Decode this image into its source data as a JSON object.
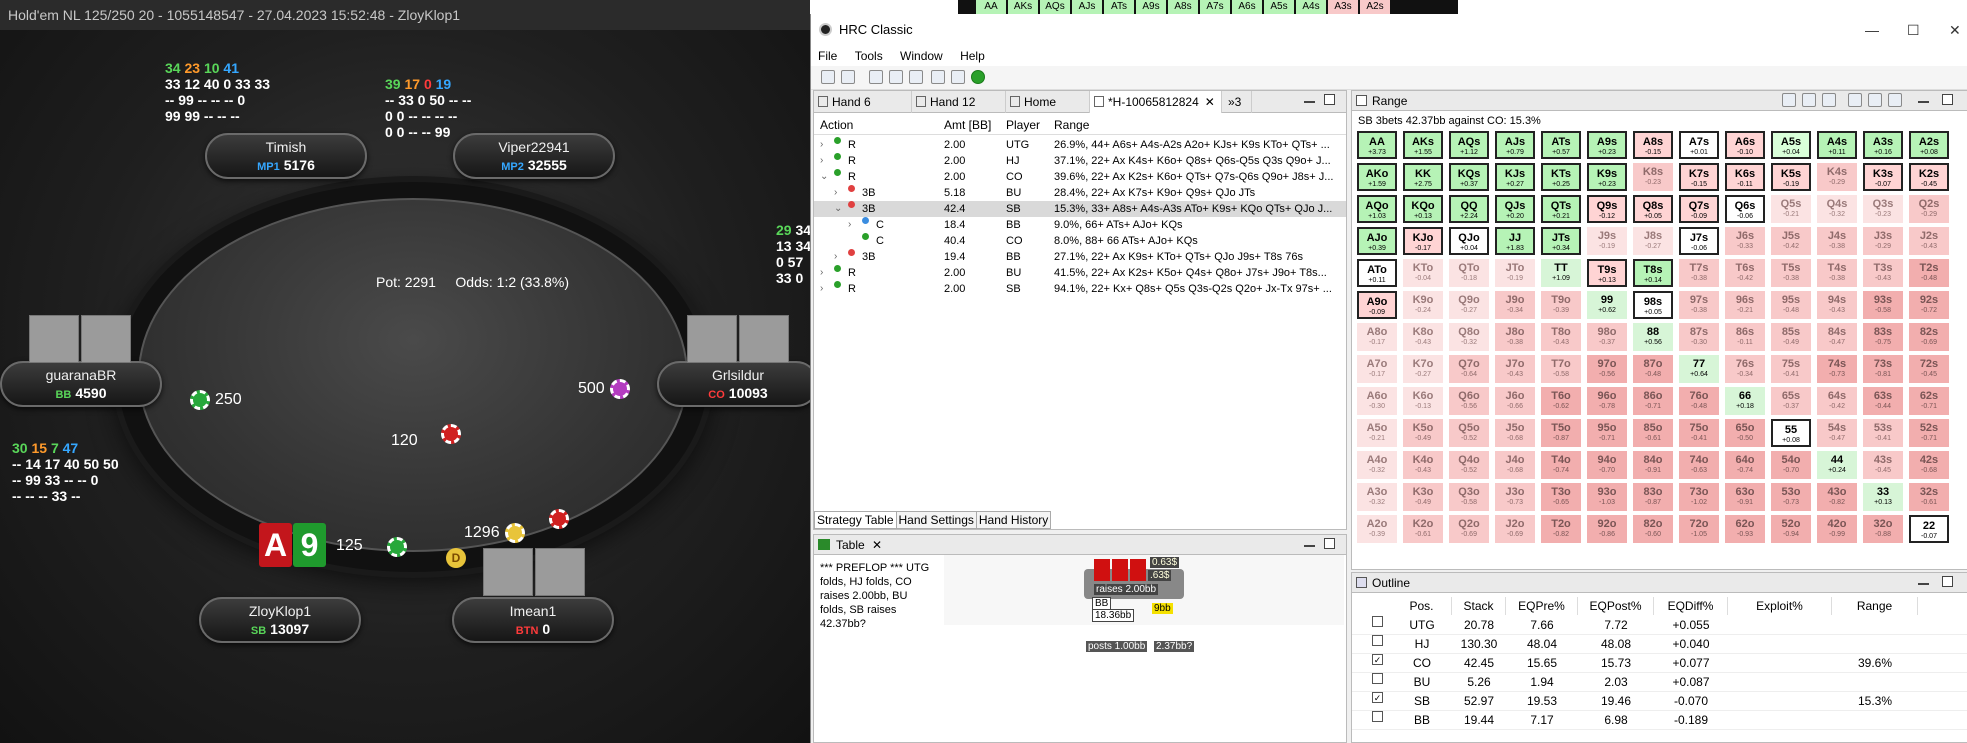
{
  "poker": {
    "title": "Hold'em NL 125/250 20 - 1055148547 - 27.04.2023 15:52:48 - ZloyKlop1",
    "pot_label": "Pot:",
    "pot_value": "2291",
    "odds_label": "Odds:",
    "odds_value": "1:2 (33.8%)",
    "players": {
      "timish": {
        "name": "Timish",
        "pos": "MP1",
        "stack": "5176"
      },
      "viper": {
        "name": "Viper22941",
        "pos": "MP2",
        "stack": "32555"
      },
      "guarana": {
        "name": "guaranaBR",
        "pos": "BB",
        "stack": "4590"
      },
      "grlsildur": {
        "name": "Grlsildur",
        "pos": "CO",
        "stack": "10093"
      },
      "zloy": {
        "name": "ZloyKlop1",
        "pos": "SB",
        "stack": "13097"
      },
      "imean": {
        "name": "Imean1",
        "pos": "BTN",
        "stack": "0"
      }
    },
    "stats": {
      "timish": {
        "a": "34",
        "b": "23",
        "c": "10",
        "d": "41",
        "l2": "33 12 40 0 33 33",
        "l3": "-- 99 -- -- -- 0",
        "l4": "99 99 -- -- --"
      },
      "viper": {
        "a": "39",
        "b": "17",
        "c": "0",
        "d": "19",
        "l2": "-- 33 0 50 -- --",
        "l3": "0 0 -- -- -- --",
        "l4": "0 0 -- -- 99"
      },
      "guarana": {
        "a": "30",
        "b": "15",
        "c": "7",
        "d": "47",
        "l2": "-- 14 17 40 50 50",
        "l3": "-- 99 33 -- -- 0",
        "l4": "-- -- -- 33 --"
      },
      "right": {
        "a": "29",
        "b": "34",
        "l2": "13 34",
        "l3": "0 57",
        "l4": "33 0"
      }
    },
    "bets": {
      "guarana": "250",
      "grlsildur": "500",
      "center": "120",
      "zloy": "125",
      "imean": "1296"
    },
    "hole_cards": {
      "c1": "A",
      "c2": "9"
    },
    "dealer": "D"
  },
  "strip": [
    "AA",
    "AKs",
    "AQs",
    "AJs",
    "ATs",
    "A9s",
    "A8s",
    "A7s",
    "A6s",
    "A5s",
    "A4s",
    "A3s",
    "A2s"
  ],
  "hrc": {
    "window_title": "HRC Classic",
    "menu": [
      "File",
      "Tools",
      "Window",
      "Help"
    ],
    "tabs": [
      {
        "label": "Hand 6"
      },
      {
        "label": "Hand 12"
      },
      {
        "label": "Home"
      },
      {
        "label": "*H-10065812824"
      },
      {
        "label": "»3"
      }
    ],
    "action_headers": {
      "action": "Action",
      "amt": "Amt [BB]",
      "player": "Player",
      "range": "Range"
    },
    "actions": [
      {
        "act": "R",
        "amt": "2.00",
        "player": "UTG",
        "range": "26.9%, 44+ A6s+ A4s-A2s A2o+ KJs+ K9s KTo+ QTs+ ...",
        "color": "#2aa02a",
        "indent": 0,
        "exp": "›"
      },
      {
        "act": "R",
        "amt": "2.00",
        "player": "HJ",
        "range": "37.1%, 22+ Ax K4s+ K6o+ Q8s+ Q6s-Q5s Q3s Q9o+ J...",
        "color": "#2aa02a",
        "indent": 0,
        "exp": "›"
      },
      {
        "act": "R",
        "amt": "2.00",
        "player": "CO",
        "range": "39.6%, 22+ Ax K2s+ K6o+ QTs+ Q7s-Q6s Q9o+ J8s+ J...",
        "color": "#2aa02a",
        "indent": 0,
        "exp": "⌄"
      },
      {
        "act": "3B",
        "amt": "5.18",
        "player": "BU",
        "range": "28.4%, 22+ Ax K7s+ K9o+ Q9s+ QJo JTs",
        "color": "#e04040",
        "indent": 1,
        "exp": "›"
      },
      {
        "act": "3B",
        "amt": "42.4",
        "player": "SB",
        "range": "15.3%, 33+ A8s+ A4s-A3s ATo+ K9s+ KQo QTs+ QJo J...",
        "color": "#e04040",
        "indent": 1,
        "exp": "⌄",
        "sel": true
      },
      {
        "act": "C",
        "amt": "18.4",
        "player": "BB",
        "range": "9.0%, 66+ ATs+ AJo+ KQs",
        "color": "#3b8de0",
        "indent": 2,
        "exp": "›"
      },
      {
        "act": "C",
        "amt": "40.4",
        "player": "CO",
        "range": "8.0%, 88+ 66 ATs+ AJo+ KQs",
        "color": "#2aa02a",
        "indent": 2,
        "exp": ""
      },
      {
        "act": "3B",
        "amt": "19.4",
        "player": "BB",
        "range": "27.1%, 22+ Ax K9s+ KTo+ QTs+ QJo J9s+ T8s 76s",
        "color": "#e04040",
        "indent": 1,
        "exp": "›"
      },
      {
        "act": "R",
        "amt": "2.00",
        "player": "BU",
        "range": "41.5%, 22+ Ax K2s+ K5o+ Q4s+ Q8o+ J7s+ J9o+ T8s...",
        "color": "#2aa02a",
        "indent": 0,
        "exp": "›"
      },
      {
        "act": "R",
        "amt": "2.00",
        "player": "SB",
        "range": "94.1%, 22+ Kx+ Q8s+ Q5s Q3s-Q2s Q2o+ Jx-Tx 97s+ ...",
        "color": "#2aa02a",
        "indent": 0,
        "exp": "›"
      }
    ],
    "subtabs": [
      "Strategy Table",
      "Hand Settings",
      "Hand History"
    ],
    "table_tab": "Table",
    "preflop_text": "*** PREFLOP *** UTG folds, HJ folds, CO raises 2.00bb, BU folds, SB raises 42.37bb?",
    "mini": {
      "raises": "raises 2.00bb",
      "posts": "posts 1.00bb",
      "bb": "BB",
      "bb_stack": "18.36bb",
      "amt1": "0.63$",
      "amt2": ".63$",
      "raise2": "2.37bb?",
      "yb": "9bb"
    },
    "range_tab": "Range",
    "range_subtitle": "SB 3bets 42.37bb against CO: 15.3%",
    "outline_tab": "Outline",
    "outline_headers": [
      "Pos.",
      "Stack",
      "EQPre%",
      "EQPost%",
      "EQDiff%",
      "Exploit%",
      "Range"
    ],
    "outline_rows": [
      {
        "checked": false,
        "pos": "UTG",
        "stack": "20.78",
        "pre": "7.66",
        "post": "7.72",
        "diff": "+0.055",
        "exploit": "",
        "range": ""
      },
      {
        "checked": false,
        "pos": "HJ",
        "stack": "130.30",
        "pre": "48.04",
        "post": "48.08",
        "diff": "+0.040",
        "exploit": "",
        "range": ""
      },
      {
        "checked": true,
        "pos": "CO",
        "stack": "42.45",
        "pre": "15.65",
        "post": "15.73",
        "diff": "+0.077",
        "exploit": "",
        "range": "39.6%"
      },
      {
        "checked": false,
        "pos": "BU",
        "stack": "5.26",
        "pre": "1.94",
        "post": "2.03",
        "diff": "+0.087",
        "exploit": "",
        "range": ""
      },
      {
        "checked": true,
        "pos": "SB",
        "stack": "52.97",
        "pre": "19.53",
        "post": "19.46",
        "diff": "-0.070",
        "exploit": "",
        "range": "15.3%"
      },
      {
        "checked": false,
        "pos": "BB",
        "stack": "19.44",
        "pre": "7.17",
        "post": "6.98",
        "diff": "-0.189",
        "exploit": "",
        "range": ""
      }
    ]
  },
  "grid": [
    [
      [
        "AA",
        "+3.73",
        "raise"
      ],
      [
        "AKs",
        "+1.55",
        "raise"
      ],
      [
        "AQs",
        "+1.12",
        "raise"
      ],
      [
        "AJs",
        "+0.79",
        "raise"
      ],
      [
        "ATs",
        "+0.57",
        "raise"
      ],
      [
        "A9s",
        "+0.23",
        "raise"
      ],
      [
        "A8s",
        "-0.15",
        "call"
      ],
      [
        "A7s",
        "+0.01",
        "white"
      ],
      [
        "A6s",
        "-0.10",
        "call"
      ],
      [
        "A5s",
        "+0.04",
        "raise-pos"
      ],
      [
        "A4s",
        "+0.11",
        "raise"
      ],
      [
        "A3s",
        "+0.16",
        "raise"
      ],
      [
        "A2s",
        "+0.08",
        "raise"
      ]
    ],
    [
      [
        "AKo",
        "+1.59",
        "raise"
      ],
      [
        "KK",
        "+2.75",
        "raise"
      ],
      [
        "KQs",
        "+0.37",
        "raise"
      ],
      [
        "KJs",
        "+0.27",
        "raise"
      ],
      [
        "KTs",
        "+0.25",
        "raise"
      ],
      [
        "K9s",
        "+0.23",
        "raise"
      ],
      [
        "K8s",
        "-0.23",
        "pink2"
      ],
      [
        "K7s",
        "-0.15",
        "call"
      ],
      [
        "K6s",
        "-0.11",
        "call"
      ],
      [
        "K5s",
        "-0.19",
        "call"
      ],
      [
        "K4s",
        "-0.29",
        "pink2"
      ],
      [
        "K3s",
        "-0.07",
        "call"
      ],
      [
        "K2s",
        "-0.45",
        "call"
      ]
    ],
    [
      [
        "AQo",
        "+1.03",
        "raise"
      ],
      [
        "KQo",
        "+0.13",
        "raise"
      ],
      [
        "QQ",
        "+2.24",
        "raise"
      ],
      [
        "QJs",
        "+0.20",
        "raise"
      ],
      [
        "QTs",
        "+0.21",
        "raise"
      ],
      [
        "Q9s",
        "-0.12",
        "call"
      ],
      [
        "Q8s",
        "+0.05",
        "call"
      ],
      [
        "Q7s",
        "-0.09",
        "call"
      ],
      [
        "Q6s",
        "-0.06",
        "white"
      ],
      [
        "Q5s",
        "-0.21",
        "pink1"
      ],
      [
        "Q4s",
        "-0.32",
        "pink1"
      ],
      [
        "Q3s",
        "-0.23",
        "pink1"
      ],
      [
        "Q2s",
        "-0.29",
        "pink2"
      ]
    ],
    [
      [
        "AJo",
        "+0.39",
        "raise"
      ],
      [
        "KJo",
        "-0.17",
        "call"
      ],
      [
        "QJo",
        "+0.04",
        "white"
      ],
      [
        "JJ",
        "+1.83",
        "raise"
      ],
      [
        "JTs",
        "+0.34",
        "raise"
      ],
      [
        "J9s",
        "-0.19",
        "pink1"
      ],
      [
        "J8s",
        "-0.27",
        "pink1"
      ],
      [
        "J7s",
        "-0.06",
        "white"
      ],
      [
        "J6s",
        "-0.33",
        "pink2"
      ],
      [
        "J5s",
        "-0.42",
        "pink2"
      ],
      [
        "J4s",
        "-0.38",
        "pink2"
      ],
      [
        "J3s",
        "-0.29",
        "pink2"
      ],
      [
        "J2s",
        "-0.43",
        "pink2"
      ]
    ],
    [
      [
        "ATo",
        "+0.11",
        "white"
      ],
      [
        "KTo",
        "-0.04",
        "pink1"
      ],
      [
        "QTo",
        "-0.18",
        "pink1"
      ],
      [
        "JTo",
        "-0.19",
        "pink1"
      ],
      [
        "TT",
        "+1.09",
        "mixg"
      ],
      [
        "T9s",
        "+0.13",
        "call"
      ],
      [
        "T8s",
        "+0.14",
        "raise"
      ],
      [
        "T7s",
        "-0.38",
        "pink2"
      ],
      [
        "T6s",
        "-0.42",
        "pink2"
      ],
      [
        "T5s",
        "-0.38",
        "pink2"
      ],
      [
        "T4s",
        "-0.38",
        "pink2"
      ],
      [
        "T3s",
        "-0.43",
        "pink2"
      ],
      [
        "T2s",
        "-0.48",
        "pink3"
      ]
    ],
    [
      [
        "A9o",
        "-0.09",
        "call"
      ],
      [
        "K9o",
        "-0.24",
        "pink1"
      ],
      [
        "Q9o",
        "-0.27",
        "pink1"
      ],
      [
        "J9o",
        "-0.34",
        "pink2"
      ],
      [
        "T9o",
        "-0.39",
        "pink2"
      ],
      [
        "99",
        "+0.62",
        "mixg"
      ],
      [
        "98s",
        "+0.05",
        "white"
      ],
      [
        "97s",
        "-0.38",
        "pink2"
      ],
      [
        "96s",
        "-0.21",
        "pink2"
      ],
      [
        "95s",
        "-0.48",
        "pink2"
      ],
      [
        "94s",
        "-0.43",
        "pink2"
      ],
      [
        "93s",
        "-0.58",
        "pink3"
      ],
      [
        "92s",
        "-0.72",
        "pink3"
      ]
    ],
    [
      [
        "A8o",
        "-0.17",
        "pink1"
      ],
      [
        "K8o",
        "-0.43",
        "pink1"
      ],
      [
        "Q8o",
        "-0.32",
        "pink1"
      ],
      [
        "J8o",
        "-0.38",
        "pink2"
      ],
      [
        "T8o",
        "-0.43",
        "pink2"
      ],
      [
        "98o",
        "-0.37",
        "pink2"
      ],
      [
        "88",
        "+0.56",
        "mixg"
      ],
      [
        "87s",
        "-0.30",
        "pink2"
      ],
      [
        "86s",
        "-0.11",
        "pink2"
      ],
      [
        "85s",
        "-0.49",
        "pink2"
      ],
      [
        "84s",
        "-0.47",
        "pink2"
      ],
      [
        "83s",
        "-0.75",
        "pink3"
      ],
      [
        "82s",
        "-0.69",
        "pink3"
      ]
    ],
    [
      [
        "A7o",
        "-0.17",
        "pink1"
      ],
      [
        "K7o",
        "-0.27",
        "pink1"
      ],
      [
        "Q7o",
        "-0.64",
        "pink2"
      ],
      [
        "J7o",
        "-0.43",
        "pink2"
      ],
      [
        "T7o",
        "-0.58",
        "pink2"
      ],
      [
        "97o",
        "-0.56",
        "pink3"
      ],
      [
        "87o",
        "-0.48",
        "pink3"
      ],
      [
        "77",
        "+0.64",
        "mixg"
      ],
      [
        "76s",
        "-0.34",
        "pink2"
      ],
      [
        "75s",
        "-0.41",
        "pink2"
      ],
      [
        "74s",
        "-0.73",
        "pink3"
      ],
      [
        "73s",
        "-0.81",
        "pink3"
      ],
      [
        "72s",
        "-0.45",
        "pink3"
      ]
    ],
    [
      [
        "A6o",
        "-0.30",
        "pink1"
      ],
      [
        "K6o",
        "-0.13",
        "pink1"
      ],
      [
        "Q6o",
        "-0.56",
        "pink2"
      ],
      [
        "J6o",
        "-0.66",
        "pink2"
      ],
      [
        "T6o",
        "-0.62",
        "pink3"
      ],
      [
        "96o",
        "-0.78",
        "pink3"
      ],
      [
        "86o",
        "-0.71",
        "pink3"
      ],
      [
        "76o",
        "-0.48",
        "pink3"
      ],
      [
        "66",
        "+0.18",
        "mixg"
      ],
      [
        "65s",
        "-0.37",
        "pink2"
      ],
      [
        "64s",
        "-0.42",
        "pink2"
      ],
      [
        "63s",
        "-0.44",
        "pink3"
      ],
      [
        "62s",
        "-0.71",
        "pink3"
      ]
    ],
    [
      [
        "A5o",
        "-0.21",
        "pink1"
      ],
      [
        "K5o",
        "-0.49",
        "pink2"
      ],
      [
        "Q5o",
        "-0.52",
        "pink2"
      ],
      [
        "J5o",
        "-0.68",
        "pink2"
      ],
      [
        "T5o",
        "-0.87",
        "pink3"
      ],
      [
        "95o",
        "-0.71",
        "pink3"
      ],
      [
        "85o",
        "-0.61",
        "pink3"
      ],
      [
        "75o",
        "-0.41",
        "pink3"
      ],
      [
        "65o",
        "-0.50",
        "pink3"
      ],
      [
        "55",
        "+0.08",
        "white"
      ],
      [
        "54s",
        "-0.47",
        "pink2"
      ],
      [
        "53s",
        "-0.41",
        "pink2"
      ],
      [
        "52s",
        "-0.71",
        "pink3"
      ]
    ],
    [
      [
        "A4o",
        "-0.32",
        "pink1"
      ],
      [
        "K4o",
        "-0.43",
        "pink2"
      ],
      [
        "Q4o",
        "-0.52",
        "pink2"
      ],
      [
        "J4o",
        "-0.68",
        "pink2"
      ],
      [
        "T4o",
        "-0.74",
        "pink3"
      ],
      [
        "94o",
        "-0.70",
        "pink3"
      ],
      [
        "84o",
        "-0.91",
        "pink3"
      ],
      [
        "74o",
        "-0.63",
        "pink3"
      ],
      [
        "64o",
        "-0.74",
        "pink3"
      ],
      [
        "54o",
        "-0.70",
        "pink3"
      ],
      [
        "44",
        "+0.24",
        "mixg"
      ],
      [
        "43s",
        "-0.45",
        "pink2"
      ],
      [
        "42s",
        "-0.68",
        "pink3"
      ]
    ],
    [
      [
        "A3o",
        "-0.32",
        "pink1"
      ],
      [
        "K3o",
        "-0.49",
        "pink2"
      ],
      [
        "Q3o",
        "-0.58",
        "pink2"
      ],
      [
        "J3o",
        "-0.73",
        "pink2"
      ],
      [
        "T3o",
        "-0.65",
        "pink3"
      ],
      [
        "93o",
        "-1.03",
        "pink3"
      ],
      [
        "83o",
        "-0.87",
        "pink3"
      ],
      [
        "73o",
        "-1.02",
        "pink3"
      ],
      [
        "63o",
        "-0.91",
        "pink3"
      ],
      [
        "53o",
        "-0.73",
        "pink3"
      ],
      [
        "43o",
        "-0.82",
        "pink3"
      ],
      [
        "33",
        "+0.13",
        "mixg"
      ],
      [
        "32s",
        "-0.61",
        "pink3"
      ]
    ],
    [
      [
        "A2o",
        "-0.39",
        "pink1"
      ],
      [
        "K2o",
        "-0.61",
        "pink2"
      ],
      [
        "Q2o",
        "-0.69",
        "pink2"
      ],
      [
        "J2o",
        "-0.69",
        "pink2"
      ],
      [
        "T2o",
        "-0.82",
        "pink3"
      ],
      [
        "92o",
        "-0.86",
        "pink3"
      ],
      [
        "82o",
        "-0.60",
        "pink3"
      ],
      [
        "72o",
        "-1.05",
        "pink3"
      ],
      [
        "62o",
        "-0.93",
        "pink3"
      ],
      [
        "52o",
        "-0.94",
        "pink3"
      ],
      [
        "42o",
        "-0.99",
        "pink3"
      ],
      [
        "32o",
        "-0.88",
        "pink3"
      ],
      [
        "22",
        "-0.07",
        "white"
      ]
    ]
  ]
}
